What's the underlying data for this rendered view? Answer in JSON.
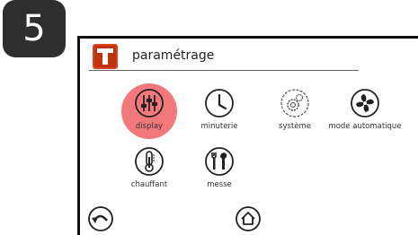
{
  "step": {
    "number": "5"
  },
  "header": {
    "title": "paramétrage"
  },
  "menu": [
    {
      "label": "display",
      "icon": "sliders-icon",
      "selected": true
    },
    {
      "label": "minuterie",
      "icon": "clock-icon"
    },
    {
      "label": "système",
      "icon": "gear-icon"
    },
    {
      "label": "mode automatique",
      "icon": "fan-icon"
    },
    {
      "label": "chauffant",
      "icon": "thermometer-icon"
    },
    {
      "label": "messe",
      "icon": "tools-icon"
    }
  ],
  "nav": {
    "back": "back-arrow-icon",
    "home": "home-icon"
  },
  "colors": {
    "highlight": "#f2787b",
    "logo": "#d9421b",
    "badge": "#2e2e2e"
  }
}
